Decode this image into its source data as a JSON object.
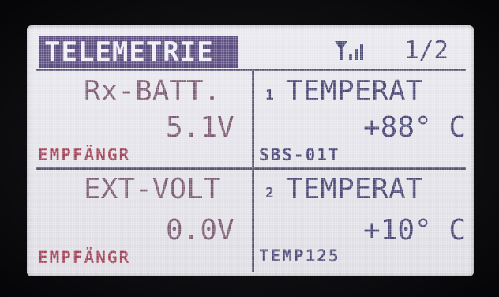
{
  "header": {
    "title": "TELEMETRIE",
    "page_indicator": "1/2",
    "signal_icon": "antenna-signal-icon"
  },
  "cells": [
    {
      "label": "Rx-BATT.",
      "value": "5.1V",
      "source": "EMPFÄNGR"
    },
    {
      "index": "1",
      "label": "TEMPERAT",
      "value": "+88° C",
      "source": "SBS-01T"
    },
    {
      "label": "EXT-VOLT",
      "value": "0.0V",
      "source": "EMPFÄNGR"
    },
    {
      "index": "2",
      "label": "TEMPERAT",
      "value": "+10° C",
      "source": "TEMP125"
    }
  ],
  "colors": {
    "lcd_background": "#e6e5eb",
    "title_background": "#5d4f82",
    "left_text": "#7d5d73",
    "right_text": "#4e4a78",
    "source_red": "#a3485c"
  }
}
